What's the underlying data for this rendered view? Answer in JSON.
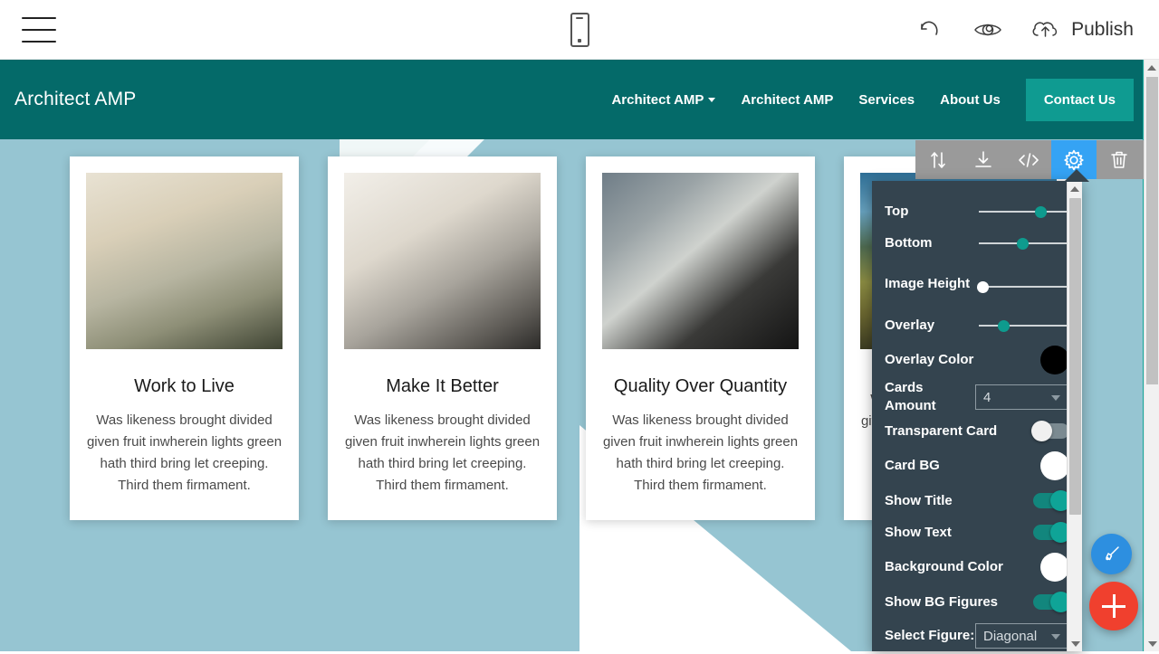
{
  "editor_bar": {
    "menu_icon": "hamburger-menu-icon",
    "device_icon": "mobile-device-icon",
    "undo_icon": "undo-arrow-icon",
    "preview_icon": "eye-preview-icon",
    "publish_icon": "cloud-upload-icon",
    "publish_label": "Publish"
  },
  "site": {
    "navbar": {
      "brand": "Architect AMP",
      "links": [
        {
          "label": "Architect AMP",
          "has_caret": true
        },
        {
          "label": "Architect AMP",
          "has_caret": false
        },
        {
          "label": "Services",
          "has_caret": false
        },
        {
          "label": "About Us",
          "has_caret": false
        }
      ],
      "cta_label": "Contact Us",
      "bg_color": "#046a69",
      "cta_color": "#0f9b91"
    },
    "cards_section": {
      "bg_color": "#96c5d2",
      "cards": [
        {
          "image": "flat-lay-tablet-food-photography",
          "title": "Work to Live",
          "text": "Was likeness brought divided given fruit inwherein lights green hath third bring let creeping. Third them firmament."
        },
        {
          "image": "hands-tablet-camera-desk-flat-lay",
          "title": "Make It Better",
          "text": "Was likeness brought divided given fruit inwherein lights green hath third bring let creeping. Third them firmament."
        },
        {
          "image": "chess-board-hands-playing",
          "title": "Quality Over Quantity",
          "text": "Was likeness brought divided given fruit inwherein lights green hath third bring let creeping. Third them firmament."
        },
        {
          "image": "mountain-landscape-field",
          "title": "",
          "text": "Was likeness brought divided given fruit inwherein lights green hath third bring let creeping. Third them firmament."
        }
      ]
    }
  },
  "component_toolbar": {
    "buttons": [
      {
        "icon": "move-updown-icon",
        "active": false
      },
      {
        "icon": "download-icon",
        "active": false
      },
      {
        "icon": "code-brackets-icon",
        "active": false
      },
      {
        "icon": "gear-settings-icon",
        "active": true
      },
      {
        "icon": "trash-delete-icon",
        "active": false
      }
    ],
    "active_color": "#35a3f4",
    "bg_color": "#9a9a9a"
  },
  "settings_panel": {
    "bg_color": "#34444f",
    "accent_color": "#0e9b8e",
    "rows": [
      {
        "label": "Top",
        "type": "slider",
        "value": 66,
        "thumb": "teal"
      },
      {
        "label": "Bottom",
        "type": "slider",
        "value": 47,
        "thumb": "teal"
      },
      {
        "label": "Image Height",
        "type": "slider",
        "value": 0,
        "thumb": "white"
      },
      {
        "label": "Overlay",
        "type": "slider",
        "value": 26,
        "thumb": "teal"
      },
      {
        "label": "Overlay Color",
        "type": "color",
        "value": "#000000"
      },
      {
        "label": "Cards Amount",
        "type": "select",
        "value": "4"
      },
      {
        "label": "Transparent Card",
        "type": "toggle",
        "value": "off"
      },
      {
        "label": "Card BG",
        "type": "color",
        "value": "#ffffff"
      },
      {
        "label": "Show Title",
        "type": "toggle",
        "value": "on"
      },
      {
        "label": "Show Text",
        "type": "toggle",
        "value": "on"
      },
      {
        "label": "Background Color",
        "type": "color",
        "value": "#ffffff"
      },
      {
        "label": "Show BG Figures",
        "type": "toggle",
        "value": "on"
      },
      {
        "label": "Select Figure:",
        "type": "select",
        "value": "Diagonal"
      }
    ]
  },
  "floating_buttons": {
    "style_icon": "paintbrush-icon",
    "add_icon": "plus-icon",
    "style_color": "#2d8fe0",
    "add_color": "#f0402e"
  }
}
